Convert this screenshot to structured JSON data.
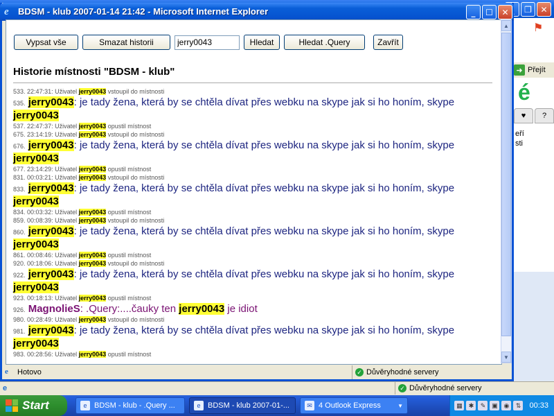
{
  "window_title": "BDSM - klub 2007-01-14 21:42 - Microsoft Internet Explorer",
  "toolbar": {
    "list_all_label": "Vypsat vše",
    "clear_history_label": "Smazat historii",
    "search_value": "jerry0043",
    "search_label": "Hledat",
    "search_query_label": "Hledat .Query",
    "close_label": "Zavřít"
  },
  "room_heading": "Historie místnosti \"BDSM - klub\"",
  "log": [
    {
      "num": "533.",
      "time": "22:47:31:",
      "text_pre": "Uživatel",
      "user": "jerry0043",
      "text_post": "vstoupil do místnosti"
    },
    {
      "num": "535.",
      "nick": "jerry0043",
      "message": ": je tady žena, která by se chtěla dívat přes webku na skype jak si ho honím, skype",
      "tail": "jerry0043"
    },
    {
      "num": "537.",
      "time": "22:47:37:",
      "text_pre": "Uživatel",
      "user": "jerry0043",
      "text_post": "opustil místnost"
    },
    {
      "num": "675.",
      "time": "23:14:19:",
      "text_pre": "Uživatel",
      "user": "jerry0043",
      "text_post": "vstoupil do místnosti"
    },
    {
      "num": "676.",
      "nick": "jerry0043",
      "message": ": je tady žena, která by se chtěla dívat přes webku na skype jak si ho honím, skype",
      "tail": "jerry0043"
    },
    {
      "num": "677.",
      "time": "23:14:29:",
      "text_pre": "Uživatel",
      "user": "jerry0043",
      "text_post": "opustil místnost"
    },
    {
      "num": "831.",
      "time": "00:03:21:",
      "text_pre": "Uživatel",
      "user": "jerry0043",
      "text_post": "vstoupil do místnosti"
    },
    {
      "num": "833.",
      "nick": "jerry0043",
      "message": ": je tady žena, která by se chtěla dívat přes webku na skype jak si ho honím, skype",
      "tail": "jerry0043"
    },
    {
      "num": "834.",
      "time": "00:03:32:",
      "text_pre": "Uživatel",
      "user": "jerry0043",
      "text_post": "opustil místnost"
    },
    {
      "num": "859.",
      "time": "00:08:39:",
      "text_pre": "Uživatel",
      "user": "jerry0043",
      "text_post": "vstoupil do místnosti"
    },
    {
      "num": "860.",
      "nick": "jerry0043",
      "message": ": je tady žena, která by se chtěla dívat přes webku na skype jak si ho honím, skype",
      "tail": "jerry0043"
    },
    {
      "num": "861.",
      "time": "00:08:46:",
      "text_pre": "Uživatel",
      "user": "jerry0043",
      "text_post": "opustil místnost"
    },
    {
      "num": "920.",
      "time": "00:18:06:",
      "text_pre": "Uživatel",
      "user": "jerry0043",
      "text_post": "vstoupil do místnosti"
    },
    {
      "num": "922.",
      "nick": "jerry0043",
      "message": ": je tady žena, která by se chtěla dívat přes webku na skype jak si ho honím, skype",
      "tail": "jerry0043"
    },
    {
      "num": "923.",
      "time": "00:18:13:",
      "text_pre": "Uživatel",
      "user": "jerry0043",
      "text_post": "opustil místnost"
    },
    {
      "num": "926.",
      "nick": "MagnolieS",
      "message": ": .Query:....čauky ten",
      "user": "jerry0043",
      "message_end": "je idiot"
    },
    {
      "num": "980.",
      "time": "00:28:49:",
      "text_pre": "Uživatel",
      "user": "jerry0043",
      "text_post": "vstoupil do místnosti"
    },
    {
      "num": "981.",
      "nick": "jerry0043",
      "message": ": je tady žena, která by se chtěla dívat přes webku na skype jak si ho honím, skype",
      "tail": "jerry0043"
    },
    {
      "num": "983.",
      "time": "00:28:56:",
      "text_pre": "Uživatel",
      "user": "jerry0043",
      "text_post": "opustil místnost"
    }
  ],
  "popup_status": {
    "left": "Hotovo",
    "zone": "Důvěryhodné servery"
  },
  "background": {
    "go_label": "Přejít",
    "side_text_1": "eří",
    "side_text_2": "sti",
    "status_zone": "Důvěryhodné servery"
  },
  "taskbar": {
    "start_label": "Start",
    "tasks": [
      {
        "label": "BDSM - klub - .Query ...",
        "active": false
      },
      {
        "label": "BDSM - klub 2007-01-...",
        "active": true
      },
      {
        "label": "4 Outlook Express",
        "active": false
      }
    ],
    "clock": "00:33"
  },
  "colors": {
    "highlight": "#ffff33",
    "message_text": "#1d2580",
    "magnolie": "#7a1273",
    "titlebar": "#0a5fd8"
  }
}
